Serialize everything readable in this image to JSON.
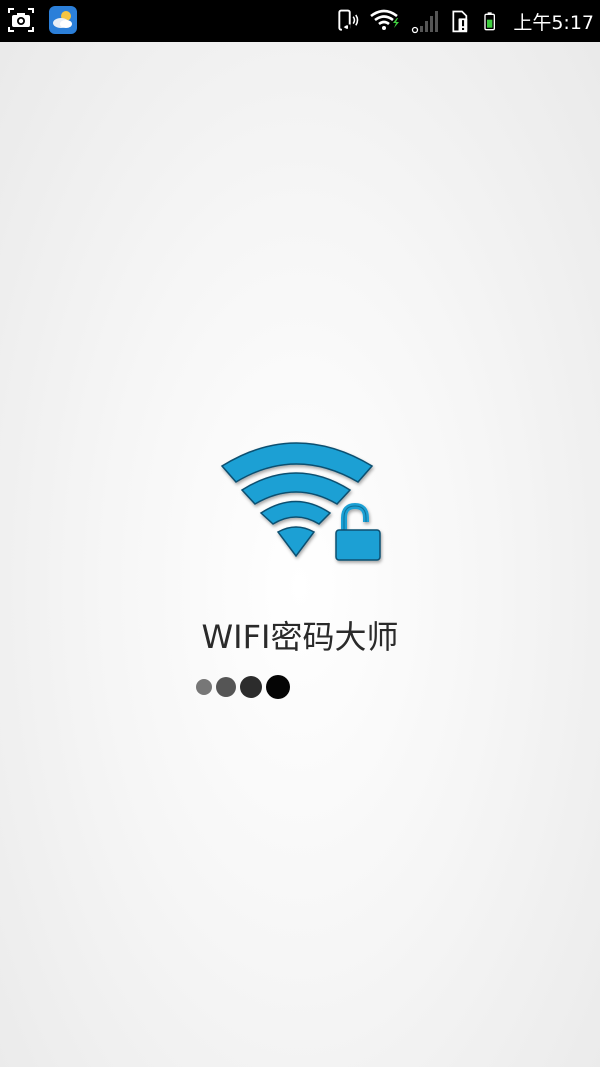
{
  "status_bar": {
    "clock": "上午5:17",
    "icons_left": [
      "screenshot-camera-icon",
      "weather-app-icon"
    ],
    "icons_right": [
      "phone-vibrate-icon",
      "wifi-icon",
      "mobile-signal-icon",
      "sim-alert-icon",
      "battery-icon"
    ]
  },
  "splash": {
    "app_name": "WIFI密码大师",
    "logo_icon": "wifi-unlock-logo-icon",
    "loading_dots": 4
  },
  "colors": {
    "status_bar_bg": "#000000",
    "logo_blue": "#1aa0d4",
    "battery_green": "#3fcf3f",
    "text": "#2a2a2a"
  }
}
